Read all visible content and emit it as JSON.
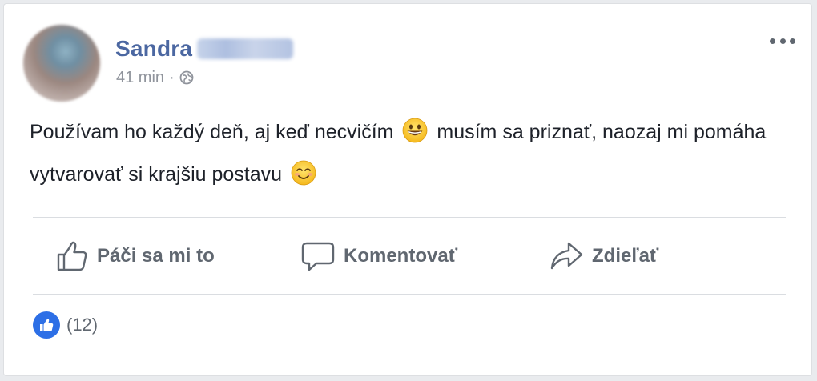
{
  "post": {
    "author_name": "Sandra",
    "timestamp": "41 min",
    "separator": "·",
    "privacy_icon": "globe-icon",
    "more_icon": "ellipsis-icon",
    "text_part1": "Používam ho každý deň, aj keď necvičím",
    "emoji1": "grinning-face-icon",
    "text_part2": " musím sa priznať, naozaj mi pomáha vytvarovať si krajšiu postavu",
    "emoji2": "smiling-face-icon"
  },
  "actions": {
    "like_label": "Páči sa mi to",
    "comment_label": "Komentovať",
    "share_label": "Zdieľať",
    "like_icon": "thumbs-up-icon",
    "comment_icon": "speech-bubble-icon",
    "share_icon": "share-arrow-icon"
  },
  "reactions": {
    "count": "(12)",
    "icon": "like-reaction-icon"
  },
  "colors": {
    "author": "#4b67a1",
    "meta": "#90949c",
    "text": "#1d2129",
    "action": "#606770",
    "like_badge": "#2d6fe6"
  }
}
